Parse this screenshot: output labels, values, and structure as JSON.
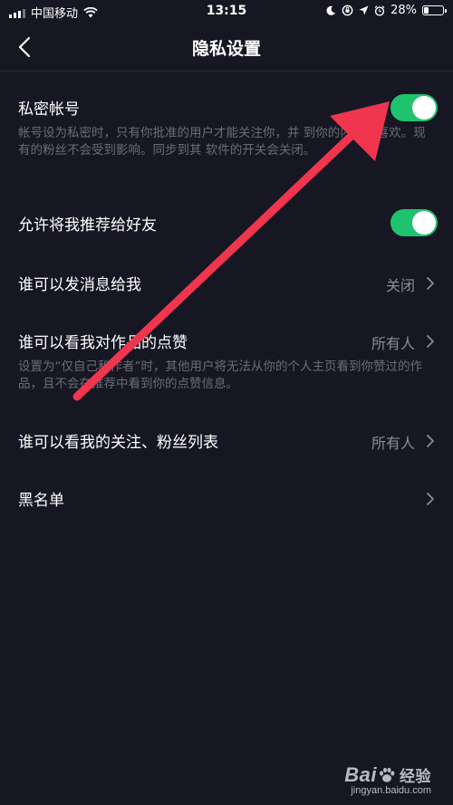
{
  "status_bar": {
    "carrier": "中国移动",
    "time": "13:15",
    "battery_percent": "28%",
    "battery_level": 0.28
  },
  "header": {
    "title": "隐私设置",
    "back_icon": "chevron-left-icon"
  },
  "settings": {
    "private_account": {
      "label": "私密帐号",
      "description": "帐号设为私密时，只有你批准的用户才能关注你，并   到你的内容和喜欢。现有的粉丝不会受到影响。同步到其   软件的开关会关闭。",
      "enabled": true
    },
    "recommend_to_friends": {
      "label": "允许将我推荐给好友",
      "enabled": true
    },
    "who_can_message": {
      "label": "谁可以发消息给我",
      "value": "关闭"
    },
    "who_can_see_likes": {
      "label": "谁可以看我对作品的点赞",
      "value": "所有人",
      "description": "设置为“仅自己和作者”时，其他用户将无法从你的个人主页看到你赞过的作品，且不会在推荐中看到你的点赞信息。"
    },
    "who_can_see_follow_lists": {
      "label": "谁可以看我的关注、粉丝列表",
      "value": "所有人"
    },
    "blacklist": {
      "label": "黑名单"
    }
  },
  "colors": {
    "background": "#161723",
    "toggle_on": "#1fc36e",
    "secondary_text": "#8b8c96",
    "description_text": "#6b6c78",
    "annotation_arrow": "#f0354f"
  },
  "watermark": {
    "logo": "Bai",
    "logo_tail": "经验",
    "url": "jingyan.baidu.com"
  }
}
